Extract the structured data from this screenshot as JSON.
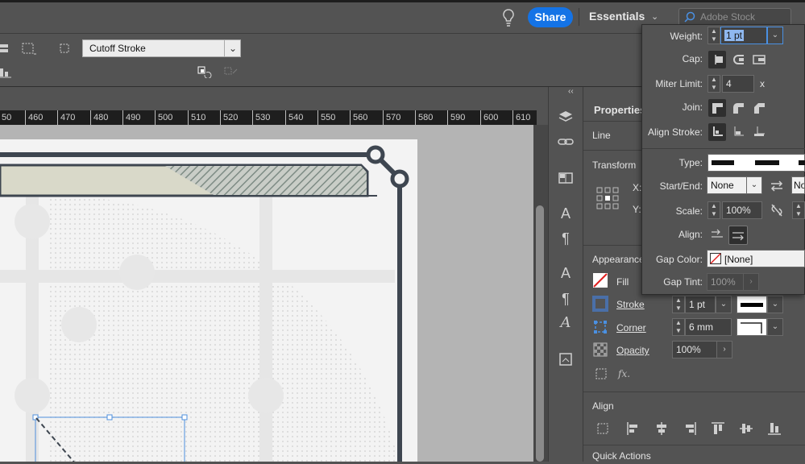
{
  "header": {
    "share_label": "Share",
    "workspace_label": "Essentials",
    "stock_placeholder": "Adobe Stock"
  },
  "control_bar": {
    "stroke_style": "Cutoff Stroke"
  },
  "ruler": {
    "ticks": [
      "50",
      "460",
      "470",
      "480",
      "490",
      "500",
      "510",
      "520",
      "530",
      "540",
      "550",
      "560",
      "570",
      "580",
      "590",
      "600",
      "610"
    ]
  },
  "properties": {
    "title": "Properties",
    "section_line": "Line",
    "section_transform": "Transform",
    "x_label": "X:",
    "y_label": "Y:",
    "section_appearance": "Appearance",
    "fill_label": "Fill",
    "stroke_label": "Stroke",
    "stroke_weight": "1 pt",
    "corner_label": "Corner",
    "corner_value": "6 mm",
    "opacity_label": "Opacity",
    "opacity_value": "100%",
    "fx_label": "fx.",
    "section_align": "Align",
    "section_quick_actions": "Quick Actions"
  },
  "stroke_popup": {
    "weight_label": "Weight:",
    "weight_value": "1 pt",
    "cap_label": "Cap:",
    "miter_label": "Miter Limit:",
    "miter_value": "4",
    "miter_x": "x",
    "join_label": "Join:",
    "align_stroke_label": "Align Stroke:",
    "type_label": "Type:",
    "start_end_label": "Start/End:",
    "start_value": "None",
    "end_value": "No",
    "scale_label": "Scale:",
    "scale_value": "100%",
    "align_label": "Align:",
    "gap_color_label": "Gap Color:",
    "gap_color_value": "[None]",
    "gap_tint_label": "Gap Tint:",
    "gap_tint_value": "100%"
  },
  "colors": {
    "accent": "#1473e6",
    "frame": "#3e4650",
    "banner": "#d9d9c9",
    "hatch": "#8e9a90"
  }
}
